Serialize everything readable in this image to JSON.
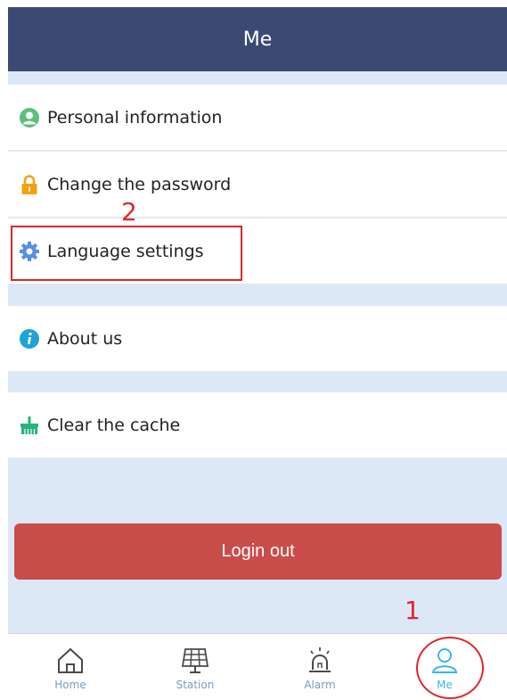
{
  "header": {
    "title": "Me"
  },
  "menu": {
    "items": [
      {
        "label": "Personal information",
        "icon": "user-circle-icon"
      },
      {
        "label": "Change the password",
        "icon": "lock-icon"
      },
      {
        "label": "Language settings",
        "icon": "gear-icon"
      },
      {
        "label": "About us",
        "icon": "info-icon"
      },
      {
        "label": "Clear the cache",
        "icon": "broom-icon"
      }
    ]
  },
  "actions": {
    "logout_label": "Login out",
    "logout_color": "#c94d4a"
  },
  "tabbar": {
    "tabs": [
      {
        "label": "Home",
        "icon": "home-icon"
      },
      {
        "label": "Station",
        "icon": "solar-panel-icon"
      },
      {
        "label": "Alarm",
        "icon": "alarm-light-icon"
      },
      {
        "label": "Me",
        "icon": "person-icon"
      }
    ],
    "active": "Me"
  },
  "annotations": {
    "step1": "1",
    "step2": "2"
  },
  "colors": {
    "header_bg": "#3b4a72",
    "page_bg": "#dce8f6",
    "tab_inactive": "#7b9ac5",
    "tab_active": "#39b6e5",
    "annotation": "#e0262b"
  }
}
